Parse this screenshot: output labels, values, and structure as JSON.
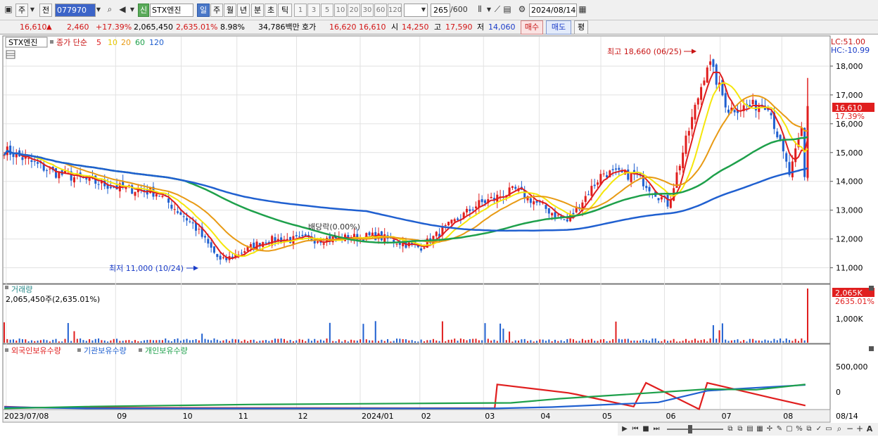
{
  "toolbar": {
    "period_type": "주",
    "prev_label": "전",
    "code": "077970",
    "shin_label": "신",
    "stock_name": "STX엔진",
    "periods": [
      "일",
      "주",
      "월",
      "년",
      "분",
      "초",
      "틱"
    ],
    "active_period": "일",
    "intervals": [
      "1",
      "3",
      "5",
      "10",
      "20",
      "30",
      "60",
      "120"
    ],
    "count": "265",
    "count_total": "/600",
    "date": "2024/08/14"
  },
  "quote": {
    "price": "16,610",
    "direction": "▲",
    "change": "2,460",
    "change_pct": "+17.39%",
    "volume": "2,065,450",
    "volume_ratio": "2,635.01%",
    "turnover": "8.98%",
    "amount": "34,786백만",
    "hoga_label": "호가",
    "ask": "16,620",
    "bid": "16,610",
    "open_label": "시",
    "open": "14,250",
    "high_label": "고",
    "high": "17,590",
    "low_label": "저",
    "low": "14,060",
    "buy_label": "매수",
    "sell_label": "매도",
    "eval_label": "평"
  },
  "chart_data": {
    "type": "candlestick",
    "legend": {
      "stock": "STX엔진",
      "title": "종가 단순",
      "ma": [
        {
          "label": "5",
          "color": "#e01e1e"
        },
        {
          "label": "10",
          "color": "#f5e60a"
        },
        {
          "label": "20",
          "color": "#e89a14"
        },
        {
          "label": "60",
          "color": "#1ea04b"
        },
        {
          "label": "120",
          "color": "#2060d0"
        }
      ]
    },
    "indicator_top_right": {
      "lc": "LC:51.00",
      "hc": "HC:-10.99"
    },
    "ylim": [
      10500,
      19000
    ],
    "yticks": [
      "18,000",
      "17,000",
      "16,000",
      "15,000",
      "14,000",
      "13,000",
      "12,000",
      "11,000"
    ],
    "current_label": {
      "price": "16,610",
      "pct": "17.39%"
    },
    "annotations": {
      "high": "최고 18,660 (06/25)",
      "low": "최저 11,000 (10/24)",
      "dividend": "배당락(0.00%)"
    },
    "price_ohlc_samples": [
      {
        "date": "2023/07/07",
        "close": 15100
      },
      {
        "date": "2023/08/01",
        "close": 14300
      },
      {
        "date": "2023/09/01",
        "close": 13800
      },
      {
        "date": "2023/09/22",
        "close": 13600
      },
      {
        "date": "2023/10/10",
        "close": 12500
      },
      {
        "date": "2023/10/24",
        "close": 11200
      },
      {
        "date": "2023/11/15",
        "close": 11950
      },
      {
        "date": "2023/12/15",
        "close": 12000
      },
      {
        "date": "2024/01/10",
        "close": 12100
      },
      {
        "date": "2024/02/01",
        "close": 11700
      },
      {
        "date": "2024/03/01",
        "close": 13200
      },
      {
        "date": "2024/03/20",
        "close": 13700
      },
      {
        "date": "2024/04/15",
        "close": 12600
      },
      {
        "date": "2024/05/03",
        "close": 14300
      },
      {
        "date": "2024/05/20",
        "close": 14200
      },
      {
        "date": "2024/06/05",
        "close": 13200
      },
      {
        "date": "2024/06/25",
        "close": 18200
      },
      {
        "date": "2024/07/05",
        "close": 16500
      },
      {
        "date": "2024/07/25",
        "close": 16700
      },
      {
        "date": "2024/08/05",
        "close": 14200
      },
      {
        "date": "2024/08/14",
        "close": 16610
      }
    ],
    "volume_panel": {
      "title": "거래량",
      "current": "2,065,450주(2,635.01%)",
      "ytick": "1,000K",
      "label": "2,065K",
      "label_pct": "2635.01%"
    },
    "holdings_panel": {
      "series": [
        "외국인보유수량",
        "기관보유수량",
        "개인보유수량"
      ],
      "colors": [
        "#e01e1e",
        "#2060d0",
        "#1ea04b"
      ],
      "yticks": [
        "500,000",
        "0"
      ]
    },
    "x_labels": [
      "2023/07/08",
      "09",
      "10",
      "11",
      "12",
      "2024/01",
      "02",
      "03",
      "04",
      "05",
      "06",
      "07",
      "08",
      "08/14"
    ]
  }
}
